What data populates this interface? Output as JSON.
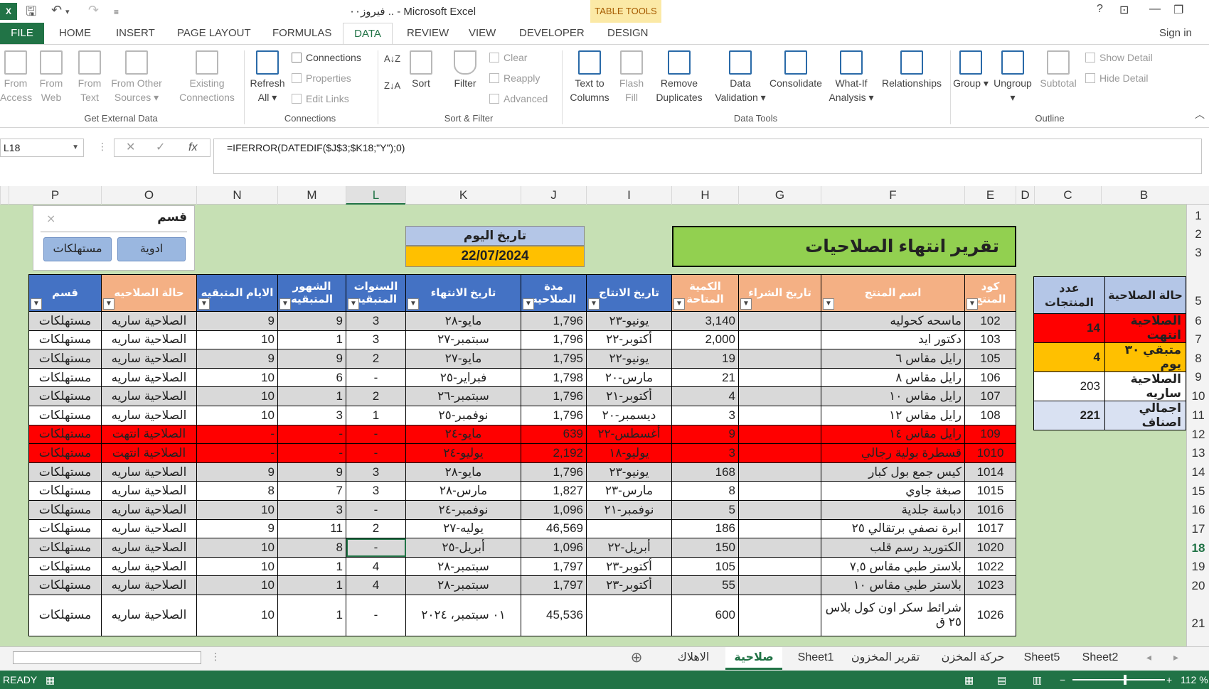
{
  "titlebar": {
    "title": "فيروز٠٠ .. - Microsoft Excel",
    "table_tools": "TABLE TOOLS",
    "help": "?",
    "minimize": "—",
    "restore": "❐",
    "close": "✕"
  },
  "tabs": {
    "file": "FILE",
    "home": "HOME",
    "insert": "INSERT",
    "page_layout": "PAGE LAYOUT",
    "formulas": "FORMULAS",
    "data": "DATA",
    "review": "REVIEW",
    "view": "VIEW",
    "developer": "DEVELOPER",
    "design": "DESIGN",
    "sign_in": "Sign in"
  },
  "ribbon": {
    "from_access": "From Access",
    "from_web": "From Web",
    "from_text": "From Text",
    "from_other": "From Other Sources ▾",
    "existing": "Existing Connections",
    "g_external": "Get External Data",
    "refresh": "Refresh All ▾",
    "connections": "Connections",
    "properties": "Properties",
    "edit_links": "Edit Links",
    "g_connections": "Connections",
    "sort": "Sort",
    "filter": "Filter",
    "clear": "Clear",
    "reapply": "Reapply",
    "advanced": "Advanced",
    "g_sort": "Sort & Filter",
    "text_to_columns": "Text to Columns",
    "flash_fill": "Flash Fill",
    "remove_dup": "Remove Duplicates",
    "data_validation": "Data Validation ▾",
    "consolidate": "Consolidate",
    "whatif": "What-If Analysis ▾",
    "relationships": "Relationships",
    "g_tools": "Data Tools",
    "group": "Group ▾",
    "ungroup": "Ungroup ▾",
    "subtotal": "Subtotal",
    "show_detail": "Show Detail",
    "hide_detail": "Hide Detail",
    "g_outline": "Outline"
  },
  "formula_bar": {
    "name_box": "L18",
    "formula": "=IFERROR(DATEDIF($J$3;$K18;\"Y\");0)"
  },
  "columns": [
    "P",
    "O",
    "N",
    "M",
    "L",
    "K",
    "J",
    "I",
    "H",
    "G",
    "F",
    "E",
    "D",
    "C",
    "B"
  ],
  "rows": [
    "1",
    "2",
    "3",
    "",
    "5",
    "6",
    "7",
    "8",
    "9",
    "10",
    "11",
    "12",
    "13",
    "14",
    "15",
    "16",
    "17",
    "18",
    "19",
    "20",
    "21"
  ],
  "banner": "تقرير انتهاء الصلاحيات",
  "today": {
    "label": "تاريخ اليوم",
    "value": "22/07/2024"
  },
  "slicer": {
    "title": "قسم",
    "btn1": "ادوية",
    "btn2": "مستهلكات"
  },
  "headers": [
    "قسم",
    "حالة الصلاحيه",
    "الايام المتبقيه",
    "الشهور المتبقيه",
    "السنوات المتبقيه",
    "تاريخ الانتهاء",
    "مدة الصلاحيه",
    "تاريخ الانتاج",
    "الكمية المتاحة",
    "تاريخ الشراء",
    "اسم المنتج",
    "كود المنتج"
  ],
  "table_rows": [
    {
      "s": "g",
      "c": [
        "مستهلكات",
        "الصلاحية ساريه",
        "9",
        "9",
        "3",
        "مايو-٢٨",
        "1,796",
        "يونيو-٢٣",
        "3,140",
        "",
        "ماسحه كحوليه",
        "102"
      ]
    },
    {
      "s": "w",
      "c": [
        "مستهلكات",
        "الصلاحية ساريه",
        "10",
        "1",
        "3",
        "سبتمبر-٢٧",
        "1,796",
        "أكتوبر-٢٢",
        "2,000",
        "",
        "دكتور ايد",
        "103"
      ]
    },
    {
      "s": "g",
      "c": [
        "مستهلكات",
        "الصلاحية ساريه",
        "9",
        "9",
        "2",
        "مايو-٢٧",
        "1,795",
        "يونيو-٢٢",
        "19",
        "",
        "رايل مقاس ٦",
        "105"
      ]
    },
    {
      "s": "w",
      "c": [
        "مستهلكات",
        "الصلاحية ساريه",
        "10",
        "6",
        "-",
        "فبراير-٢٥",
        "1,798",
        "مارس-٢٠",
        "21",
        "",
        "رايل مقاس ٨",
        "106"
      ]
    },
    {
      "s": "g",
      "c": [
        "مستهلكات",
        "الصلاحية ساريه",
        "10",
        "1",
        "2",
        "سبتمبر-٢٦",
        "1,796",
        "أكتوبر-٢١",
        "4",
        "",
        "رايل مقاس ١٠",
        "107"
      ]
    },
    {
      "s": "w",
      "c": [
        "مستهلكات",
        "الصلاحية ساريه",
        "10",
        "3",
        "1",
        "نوفمبر-٢٥",
        "1,796",
        "ديسمبر-٢٠",
        "3",
        "",
        "رايل مقاس ١٢",
        "108"
      ]
    },
    {
      "s": "r",
      "c": [
        "مستهلكات",
        "الصلاحية انتهت",
        "-",
        "-",
        "-",
        "مايو-٢٤",
        "639",
        "أغسطس-٢٢",
        "9",
        "",
        "رايل مقاس ١٤",
        "109"
      ]
    },
    {
      "s": "r",
      "c": [
        "مستهلكات",
        "الصلاحية انتهت",
        "-",
        "-",
        "-",
        "يوليو-٢٤",
        "2,192",
        "يوليو-١٨",
        "3",
        "",
        "قسطرة بولية رجالي",
        "1010"
      ]
    },
    {
      "s": "g",
      "c": [
        "مستهلكات",
        "الصلاحية ساريه",
        "9",
        "9",
        "3",
        "مايو-٢٨",
        "1,796",
        "يونيو-٢٣",
        "168",
        "",
        "كيس جمع بول كبار",
        "1014"
      ]
    },
    {
      "s": "w",
      "c": [
        "مستهلكات",
        "الصلاحية ساريه",
        "8",
        "7",
        "3",
        "مارس-٢٨",
        "1,827",
        "مارس-٢٣",
        "8",
        "",
        "صبغة جاوي",
        "1015"
      ]
    },
    {
      "s": "g",
      "c": [
        "مستهلكات",
        "الصلاحية ساريه",
        "10",
        "3",
        "-",
        "نوفمبر-٢٤",
        "1,096",
        "نوفمبر-٢١",
        "5",
        "",
        "دباسة جلدية",
        "1016"
      ]
    },
    {
      "s": "w",
      "c": [
        "مستهلكات",
        "الصلاحية ساريه",
        "9",
        "11",
        "2",
        "يوليه-٢٧",
        "46,569",
        "",
        "186",
        "",
        "ابرة نصفي برتقالي ٢٥",
        "1017"
      ]
    },
    {
      "s": "g",
      "c": [
        "مستهلكات",
        "الصلاحية ساريه",
        "10",
        "8",
        "-",
        "أبريل-٢٥",
        "1,096",
        "أبريل-٢٢",
        "150",
        "",
        "الكتوريد رسم قلب",
        "1020"
      ]
    },
    {
      "s": "w",
      "c": [
        "مستهلكات",
        "الصلاحية ساريه",
        "10",
        "1",
        "4",
        "سبتمبر-٢٨",
        "1,797",
        "أكتوبر-٢٣",
        "105",
        "",
        "بلاستر طبي مقاس ٧,٥",
        "1022"
      ]
    },
    {
      "s": "g",
      "c": [
        "مستهلكات",
        "الصلاحية ساريه",
        "10",
        "1",
        "4",
        "سبتمبر-٢٨",
        "1,797",
        "أكتوبر-٢٣",
        "55",
        "",
        "بلاستر طبي مقاس ١٠",
        "1023"
      ]
    },
    {
      "s": "w",
      "c": [
        "مستهلكات",
        "الصلاحية ساريه",
        "10",
        "1",
        "-",
        "٠١ سبتمبر، ٢٠٢٤",
        "45,536",
        "",
        "600",
        "",
        "شرائط سكر اون كول بلاس ٢٥ ق",
        "1026"
      ]
    }
  ],
  "summary": {
    "h1": "حالة الصلاحية",
    "h2": "عدد المنتجات",
    "rows": [
      {
        "label": "الصلاحية انتهت",
        "value": "14",
        "color": "#ff0000"
      },
      {
        "label": "متبقي ٣٠ يوم",
        "value": "4",
        "color": "#ffc000"
      },
      {
        "label": "الصلاحية ساريه",
        "value": "203",
        "color": "#ffffff"
      },
      {
        "label": "اجمالي اصناف",
        "value": "221",
        "color": "#d9e1f2"
      }
    ]
  },
  "sheet_tabs": [
    "Sheet2",
    "Sheet5",
    "حركة المخزن",
    "تقرير المخزون",
    "Sheet1",
    "صلاحية",
    "الاهلاك"
  ],
  "active_sheet": "صلاحية",
  "status": {
    "ready": "READY",
    "zoom": "112 %"
  },
  "colors": {
    "excel_green": "#217346",
    "header_blue": "#4472c4",
    "header_orange": "#f4b084",
    "banner_green": "#92d050",
    "expired_red": "#ff0000",
    "sheet_bg": "#c6e0b4"
  }
}
